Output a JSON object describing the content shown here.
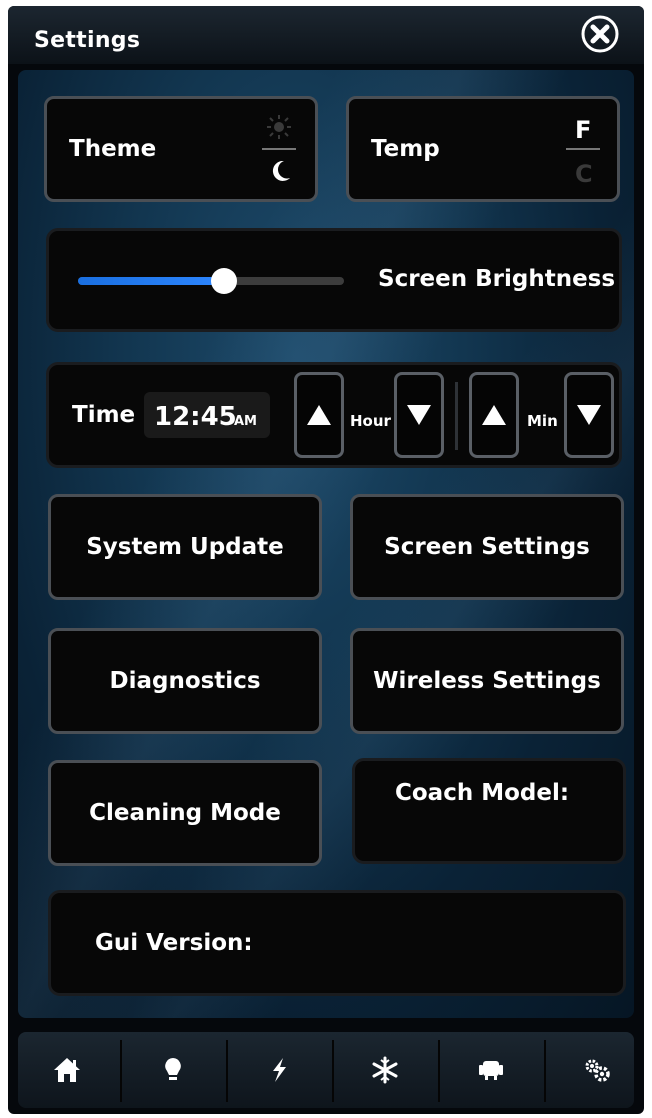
{
  "window": {
    "title": "Settings"
  },
  "theme": {
    "label": "Theme",
    "options": [
      "sun-icon",
      "moon-icon"
    ],
    "selected": "dark"
  },
  "temp": {
    "label": "Temp",
    "options": [
      "F",
      "C"
    ],
    "selected": "F"
  },
  "brightness": {
    "label": "Screen Brightness",
    "level": 0.55
  },
  "time": {
    "label": "Time",
    "value": "12:45",
    "ampm": "AM",
    "hour_label": "Hour",
    "min_label": "Min"
  },
  "buttons": {
    "system_update": "System Update",
    "screen_settings": "Screen Settings",
    "diagnostics": "Diagnostics",
    "wireless_settings": "Wireless Settings",
    "cleaning_mode": "Cleaning Mode"
  },
  "info": {
    "coach_model": "Coach Model:",
    "gui_version": "Gui Version:"
  },
  "nav": [
    "home-icon",
    "lightbulb-icon",
    "lightning-icon",
    "snowflake-icon",
    "seat-icon",
    "gears-icon"
  ],
  "colors": {
    "accent": "#2d86ff"
  }
}
